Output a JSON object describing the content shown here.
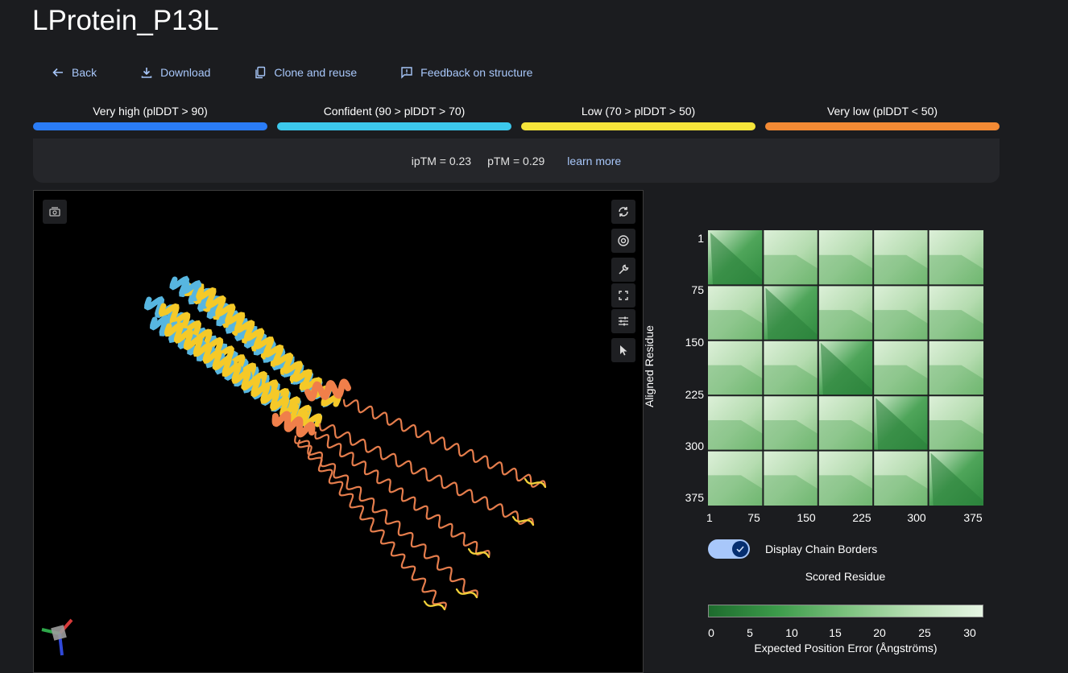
{
  "page": {
    "title": "LProtein_P13L"
  },
  "actions": {
    "back": "Back",
    "download": "Download",
    "clone": "Clone and reuse",
    "feedback": "Feedback on structure"
  },
  "legend": [
    {
      "label": "Very high (plDDT > 90)",
      "color": "#2a7cf6"
    },
    {
      "label": "Confident (90 > plDDT > 70)",
      "color": "#3cc8ec"
    },
    {
      "label": "Low (70 > plDDT > 50)",
      "color": "#f6e53a"
    },
    {
      "label": "Very low (plDDT < 50)",
      "color": "#f38a34"
    }
  ],
  "scores": {
    "iptm": "ipTM = 0.23",
    "ptm": "pTM = 0.29",
    "learn_more": "learn more"
  },
  "viewer": {
    "icons": [
      "screenshot-icon",
      "rotate-icon",
      "camera-icon",
      "wrench-icon",
      "fullscreen-icon",
      "sliders-icon",
      "cursor-icon",
      "axes-gizmo-icon"
    ]
  },
  "pae": {
    "ylabel": "Aligned Residue",
    "xlabel": "Scored Residue",
    "y_ticks": [
      "1",
      "75",
      "150",
      "225",
      "300",
      "375"
    ],
    "x_ticks": [
      "1",
      "75",
      "150",
      "225",
      "300",
      "375"
    ],
    "toggle_label": "Display Chain Borders",
    "toggle_on": true,
    "colorbar_ticks": [
      "0",
      "5",
      "10",
      "15",
      "20",
      "25",
      "30"
    ],
    "colorbar_label": "Expected Position Error (Ångströms)",
    "chains": 5,
    "colors": {
      "low_error": "#1d6b2d",
      "high_error": "#e8f6e5"
    }
  }
}
